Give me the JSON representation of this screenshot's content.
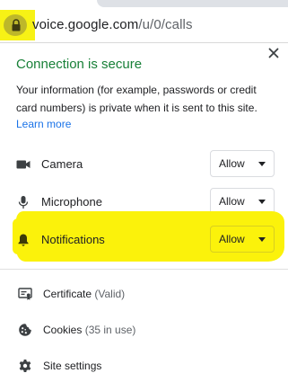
{
  "address_bar": {
    "url_host": "voice.google.com",
    "url_path": "/u/0/calls",
    "lock_icon": "lock-icon",
    "highlight_color": "#f7f215"
  },
  "popup": {
    "title": "Connection is secure",
    "title_color": "#188038",
    "description_lines": [
      "Your information (for example, passwords or credit",
      "card numbers) is private when it is sent to this site."
    ],
    "learn_more": "Learn more",
    "close_icon": "close-icon",
    "permissions": [
      {
        "label": "Camera",
        "icon": "camera-icon",
        "value": "Allow",
        "highlighted": false
      },
      {
        "label": "Microphone",
        "icon": "microphone-icon",
        "value": "Allow",
        "highlighted": false
      },
      {
        "label": "Notifications",
        "icon": "bell-icon",
        "value": "Allow",
        "highlighted": true
      }
    ],
    "links": [
      {
        "label": "Certificate",
        "note": "(Valid)",
        "icon": "certificate-icon"
      },
      {
        "label": "Cookies",
        "note": "(35 in use)",
        "icon": "cookie-icon"
      },
      {
        "label": "Site settings",
        "note": "",
        "icon": "gear-icon"
      }
    ],
    "highlight_color": "#fbf20b"
  }
}
